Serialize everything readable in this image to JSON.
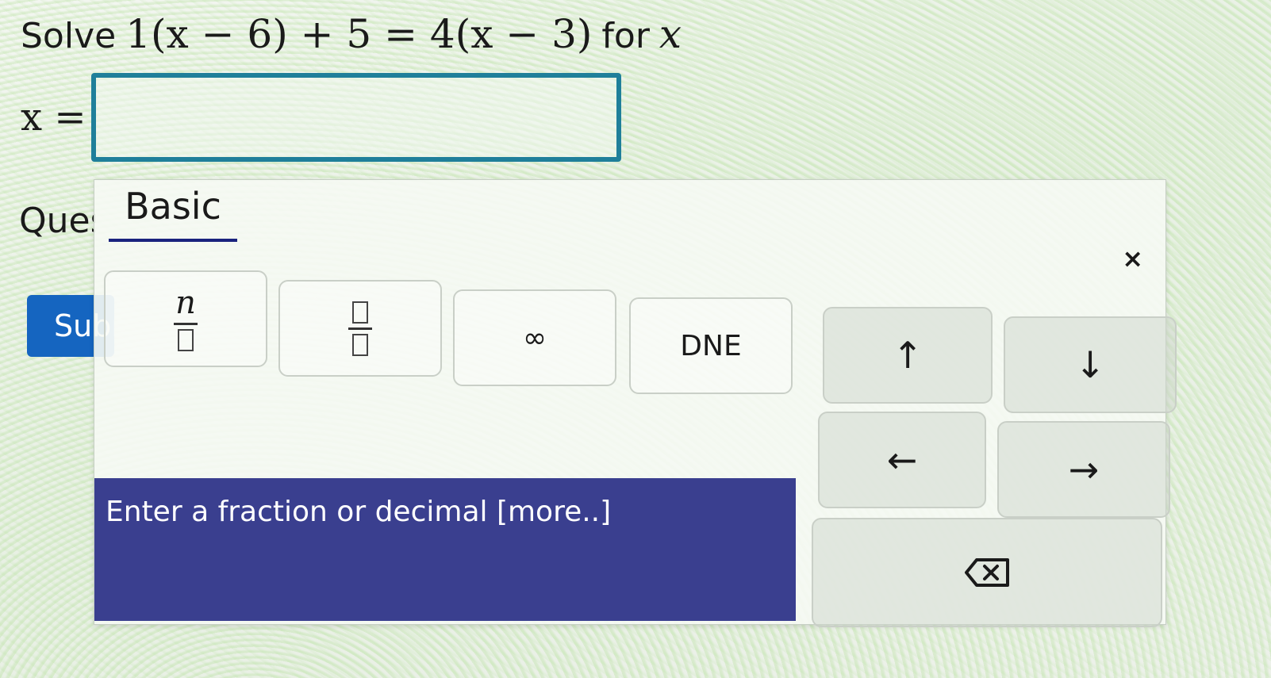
{
  "question": {
    "solve_word": "Solve",
    "equation": "1(x − 6) + 5 = 4(x − 3)",
    "for_word": "for",
    "variable": "x"
  },
  "answer": {
    "label": "x =",
    "value": ""
  },
  "question_label_partial": "Question",
  "submit_label_partial": "Submit",
  "palette": {
    "tab_label": "Basic",
    "close_symbol": "×",
    "keys": {
      "fraction_num": "n",
      "infinity": "∞",
      "dne": "DNE",
      "up": "↑",
      "down": "↓",
      "left": "←",
      "right": "→"
    },
    "hint": "Enter a fraction or decimal [more..]"
  },
  "colors": {
    "submit_bg": "#1565c0",
    "input_border": "#1f7f9a",
    "hint_bg": "#3a3f8f",
    "tab_underline": "#1a237e"
  },
  "icons": {
    "backspace": "backspace-icon",
    "close": "close-icon"
  }
}
